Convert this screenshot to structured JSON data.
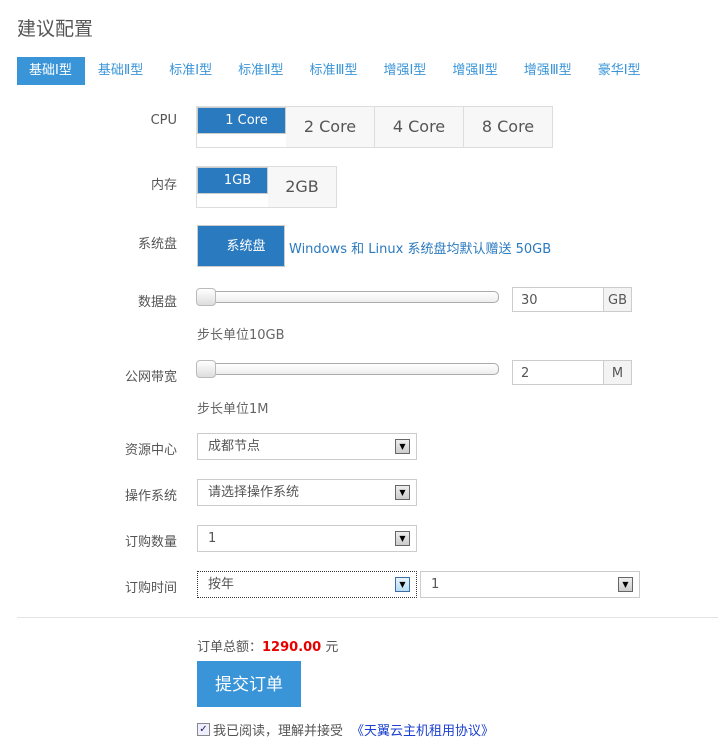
{
  "title": "建议配置",
  "tabs": [
    "基础Ⅰ型",
    "基础Ⅱ型",
    "标准Ⅰ型",
    "标准Ⅱ型",
    "标准Ⅲ型",
    "增强Ⅰ型",
    "增强Ⅱ型",
    "增强Ⅲ型",
    "豪华Ⅰ型"
  ],
  "cpu": {
    "label": "CPU",
    "options": [
      "1 Core",
      "2 Core",
      "4 Core",
      "8 Core"
    ],
    "selected": 0
  },
  "memory": {
    "label": "内存",
    "options": [
      "1GB",
      "2GB"
    ],
    "selected": 0
  },
  "system_disk": {
    "label": "系统盘",
    "button": "系统盘",
    "note": "Windows 和 Linux 系统盘均默认赠送 50GB"
  },
  "data_disk": {
    "label": "数据盘",
    "value": "30",
    "unit": "GB",
    "hint": "步长单位10GB",
    "slider_fraction": 0
  },
  "bandwidth": {
    "label": "公网带宽",
    "value": "2",
    "unit": "M",
    "hint": "步长单位1M",
    "slider_fraction": 0
  },
  "resource_center": {
    "label": "资源中心",
    "value": "成都节点"
  },
  "os": {
    "label": "操作系统",
    "value": "请选择操作系统"
  },
  "quantity": {
    "label": "订购数量",
    "value": "1"
  },
  "duration": {
    "label": "订购时间",
    "unit_value": "按年",
    "count_value": "1"
  },
  "total": {
    "label": "订单总额：",
    "amount": "1290.00",
    "currency": "元"
  },
  "submit": "提交订单",
  "agreement": {
    "text": "我已阅读，理解并接受",
    "link": "《天翼云主机租用协议》",
    "checked": true
  },
  "colors": {
    "accent": "#3a94d8",
    "selected": "#2a7ac0",
    "price": "#e60000"
  }
}
